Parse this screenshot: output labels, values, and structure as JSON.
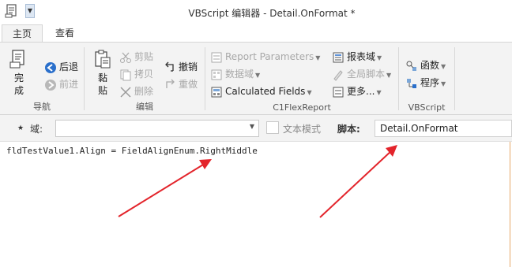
{
  "window": {
    "title": "VBScript 编辑器 - Detail.OnFormat *"
  },
  "tabs": [
    {
      "label": "主页",
      "active": true
    },
    {
      "label": "查看",
      "active": false
    }
  ],
  "ribbon": {
    "nav_group": {
      "label": "导航",
      "finish_label_1": "完",
      "finish_label_2": "成",
      "back_label": "后退",
      "forward_label": "前进"
    },
    "edit_group": {
      "label": "编辑",
      "paste_label_1": "黏",
      "paste_label_2": "贴",
      "cut_label": "剪贴",
      "copy_label": "拷贝",
      "delete_label": "删除",
      "undo_label": "撤销",
      "redo_label": "重做"
    },
    "flex_group": {
      "label": "C1FlexReport",
      "report_params_label": "Report Parameters",
      "data_fields_label": "数据域",
      "calculated_fields_label": "Calculated Fields",
      "report_fields_label": "报表域",
      "global_script_label": "全局脚本",
      "more_label": "更多..."
    },
    "vbscript_group": {
      "label": "VBScript",
      "functions_label": "函数",
      "procedures_label": "程序"
    }
  },
  "field_bar": {
    "field_label": "域:",
    "field_value": "",
    "text_mode_label": "文本模式",
    "text_mode_checked": false,
    "script_label": "脚本:",
    "script_value": "Detail.OnFormat"
  },
  "editor": {
    "code": "fldTestValue1.Align = FieldAlignEnum.RightMiddle"
  },
  "colors": {
    "accent_blue": "#2a6fcb",
    "annotation_red": "#e3242b",
    "ribbon_bg": "#f3f3f3"
  }
}
